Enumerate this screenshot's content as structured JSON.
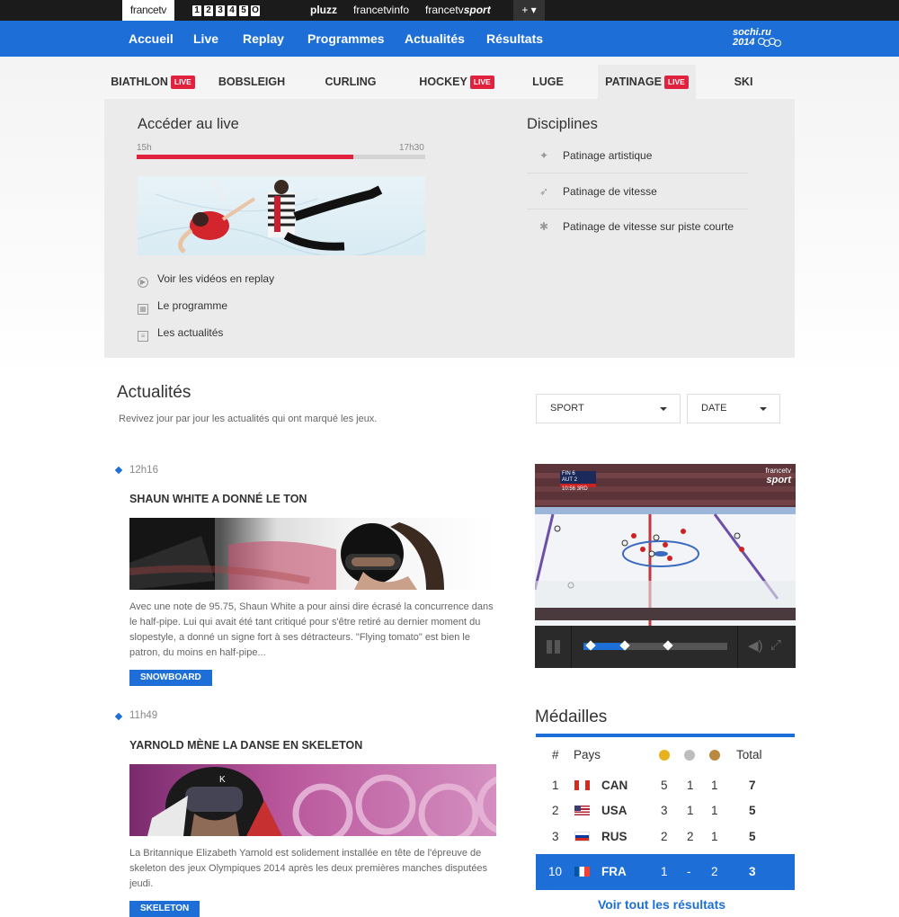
{
  "topbar": {
    "brand": "francetv",
    "channels": [
      "1",
      "2",
      "3",
      "4",
      "5",
      "O"
    ],
    "pluzz": "pluzz",
    "info": "francetvinfo",
    "sport_a": "francetv",
    "sport_b": "sport",
    "more": "+ ▾"
  },
  "nav": {
    "items": [
      "Accueil",
      "Live",
      "Replay",
      "Programmes",
      "Actualités",
      "Résultats"
    ],
    "logo_top": "sochi.ru",
    "logo_bottom": "2014"
  },
  "sports": [
    {
      "label": "BIATHLON",
      "live": true
    },
    {
      "label": "BOBSLEIGH",
      "live": false
    },
    {
      "label": "CURLING",
      "live": false
    },
    {
      "label": "HOCKEY",
      "live": true
    },
    {
      "label": "LUGE",
      "live": false
    },
    {
      "label": "PATINAGE",
      "live": true,
      "active": true
    },
    {
      "label": "SKI",
      "live": false
    }
  ],
  "live_badge": "LIVE",
  "panel": {
    "live_title": "Accéder au live",
    "time_start": "15h",
    "time_end": "17h30",
    "progress": 0.75,
    "links": [
      "Voir les vidéos en replay",
      "Le programme",
      "Les actualités"
    ],
    "disciplines_title": "Disciplines",
    "disciplines": [
      "Patinage artistique",
      "Patinage de vitesse",
      "Patinage de vitesse sur piste courte"
    ]
  },
  "news": {
    "title": "Actualités",
    "subtitle": "Revivez jour par jour les actualités qui ont marqué les jeux.",
    "filter_sport": "SPORT",
    "filter_date": "DATE",
    "articles": [
      {
        "time": "12h16",
        "title": "SHAUN WHITE A DONNÉ LE TON",
        "text": "Avec une note de 95.75, Shaun White a pour ainsi dire écrasé la concurrence dans le half-pipe. Lui qui avait été tant critiqué pour s'être retiré au dernier moment du slopestyle, a donné un signe fort à ses détracteurs. \"Flying tomato\" est bien le patron, du moins en half-pipe...",
        "tag": "SNOWBOARD"
      },
      {
        "time": "11h49",
        "title": "YARNOLD MÈNE LA DANSE EN SKELETON",
        "text": "La Britannique Elizabeth Yarnold est solidement installée en tête de l'épreuve de skeleton des jeux Olympiques 2014 après les deux premières manches disputées jeudi.",
        "tag": "SKELETON"
      }
    ]
  },
  "video": {
    "brand_top": "francetv",
    "brand_bottom": "sport",
    "score": [
      {
        "team": "FIN",
        "pts": "6"
      },
      {
        "team": "AUT",
        "pts": "2"
      }
    ],
    "clock": "10:56",
    "period": "3RD",
    "progress": 0.3
  },
  "medals": {
    "title": "Médailles",
    "headers": {
      "rank": "#",
      "country": "Pays",
      "total": "Total"
    },
    "colors": {
      "gold": "#e8b21c",
      "silver": "#bdbdbd",
      "bronze": "#b98a3e"
    },
    "rows": [
      {
        "rank": "1",
        "code": "CAN",
        "gold": "5",
        "silver": "1",
        "bronze": "1",
        "total": "7"
      },
      {
        "rank": "2",
        "code": "USA",
        "gold": "3",
        "silver": "1",
        "bronze": "1",
        "total": "5"
      },
      {
        "rank": "3",
        "code": "RUS",
        "gold": "2",
        "silver": "2",
        "bronze": "1",
        "total": "5"
      },
      {
        "rank": "10",
        "code": "FRA",
        "gold": "1",
        "silver": "-",
        "bronze": "2",
        "total": "3"
      }
    ],
    "more": "Voir tout les résultats"
  }
}
